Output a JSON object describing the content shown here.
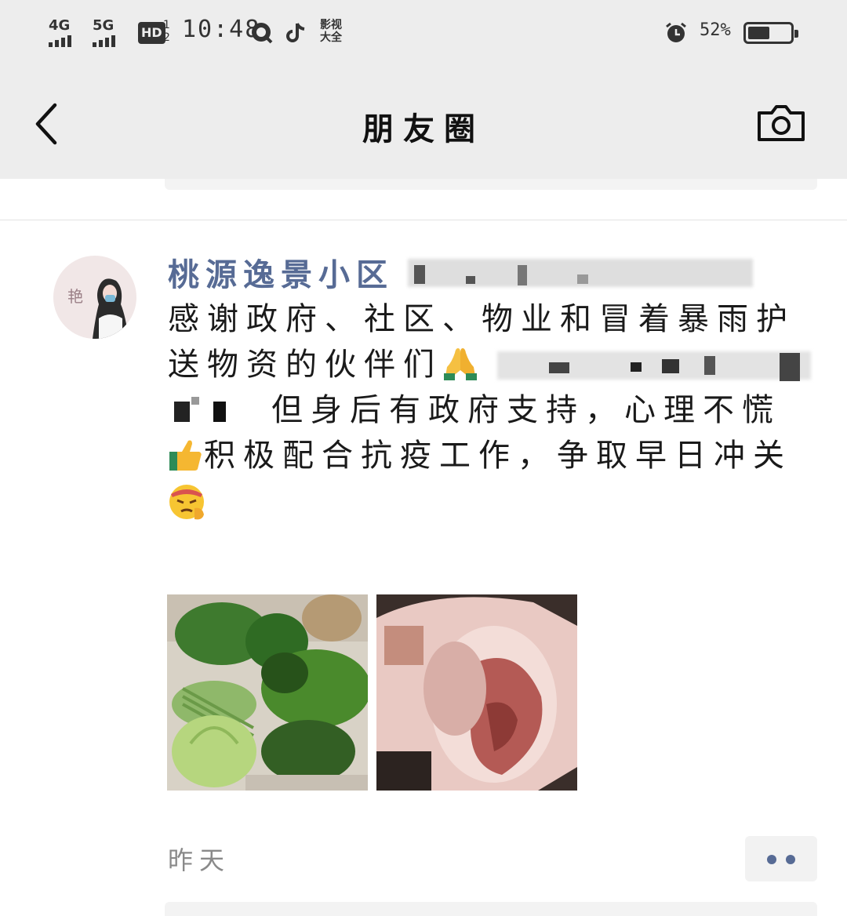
{
  "status_bar": {
    "signal1": "4G",
    "signal2": "5G",
    "hd": "HD",
    "hd_nums": "1 2",
    "time": "10:48",
    "yingshi": "影视 大全",
    "battery_pct": "52%",
    "battery_level": 0.52
  },
  "header": {
    "title": "朋友圈"
  },
  "post": {
    "author": "桃源逸景小区",
    "lines": [
      "感谢政府、社区、物业和冒着暴雨护",
      "送物资的伙伴们",
      "但身后有政府支持，心理不慌",
      "积极配合抗疫工作，争取早日冲关"
    ],
    "avatar_char": "艳",
    "time": "昨天"
  },
  "colors": {
    "header_bg": "#ededed",
    "author": "#576b95",
    "time": "#8a8a8a"
  },
  "icons": [
    "back-icon",
    "camera-icon",
    "alarm-icon",
    "pray-emoji",
    "thumbs-up-emoji",
    "determined-emoji",
    "more-icon"
  ]
}
